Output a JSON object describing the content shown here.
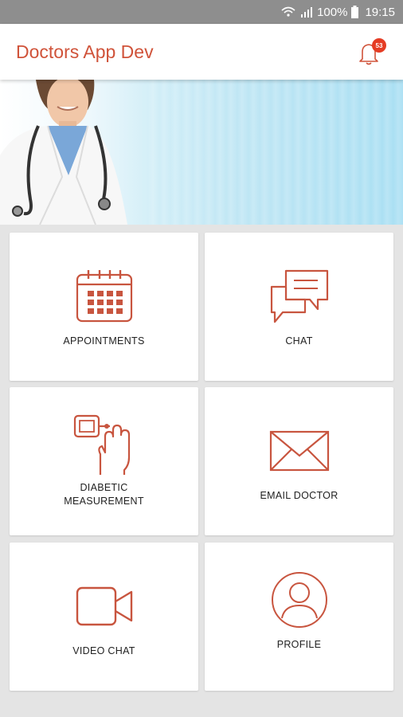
{
  "status_bar": {
    "battery": "100%",
    "time": "19:15"
  },
  "app_bar": {
    "title": "Doctors App Dev",
    "notification_count": "53"
  },
  "colors": {
    "accent": "#d0533a",
    "badge": "#e53c24",
    "icon_stroke": "#c8553f"
  },
  "tiles": [
    {
      "label": "APPOINTMENTS",
      "icon": "calendar-icon"
    },
    {
      "label": "CHAT",
      "icon": "chat-bubbles-icon"
    },
    {
      "label": "DIABETIC\nMEASUREMENT",
      "icon": "glucose-meter-icon"
    },
    {
      "label": "EMAIL DOCTOR",
      "icon": "envelope-icon"
    },
    {
      "label": "VIDEO CHAT",
      "icon": "video-camera-icon"
    },
    {
      "label": "PROFILE",
      "icon": "user-profile-icon"
    }
  ]
}
